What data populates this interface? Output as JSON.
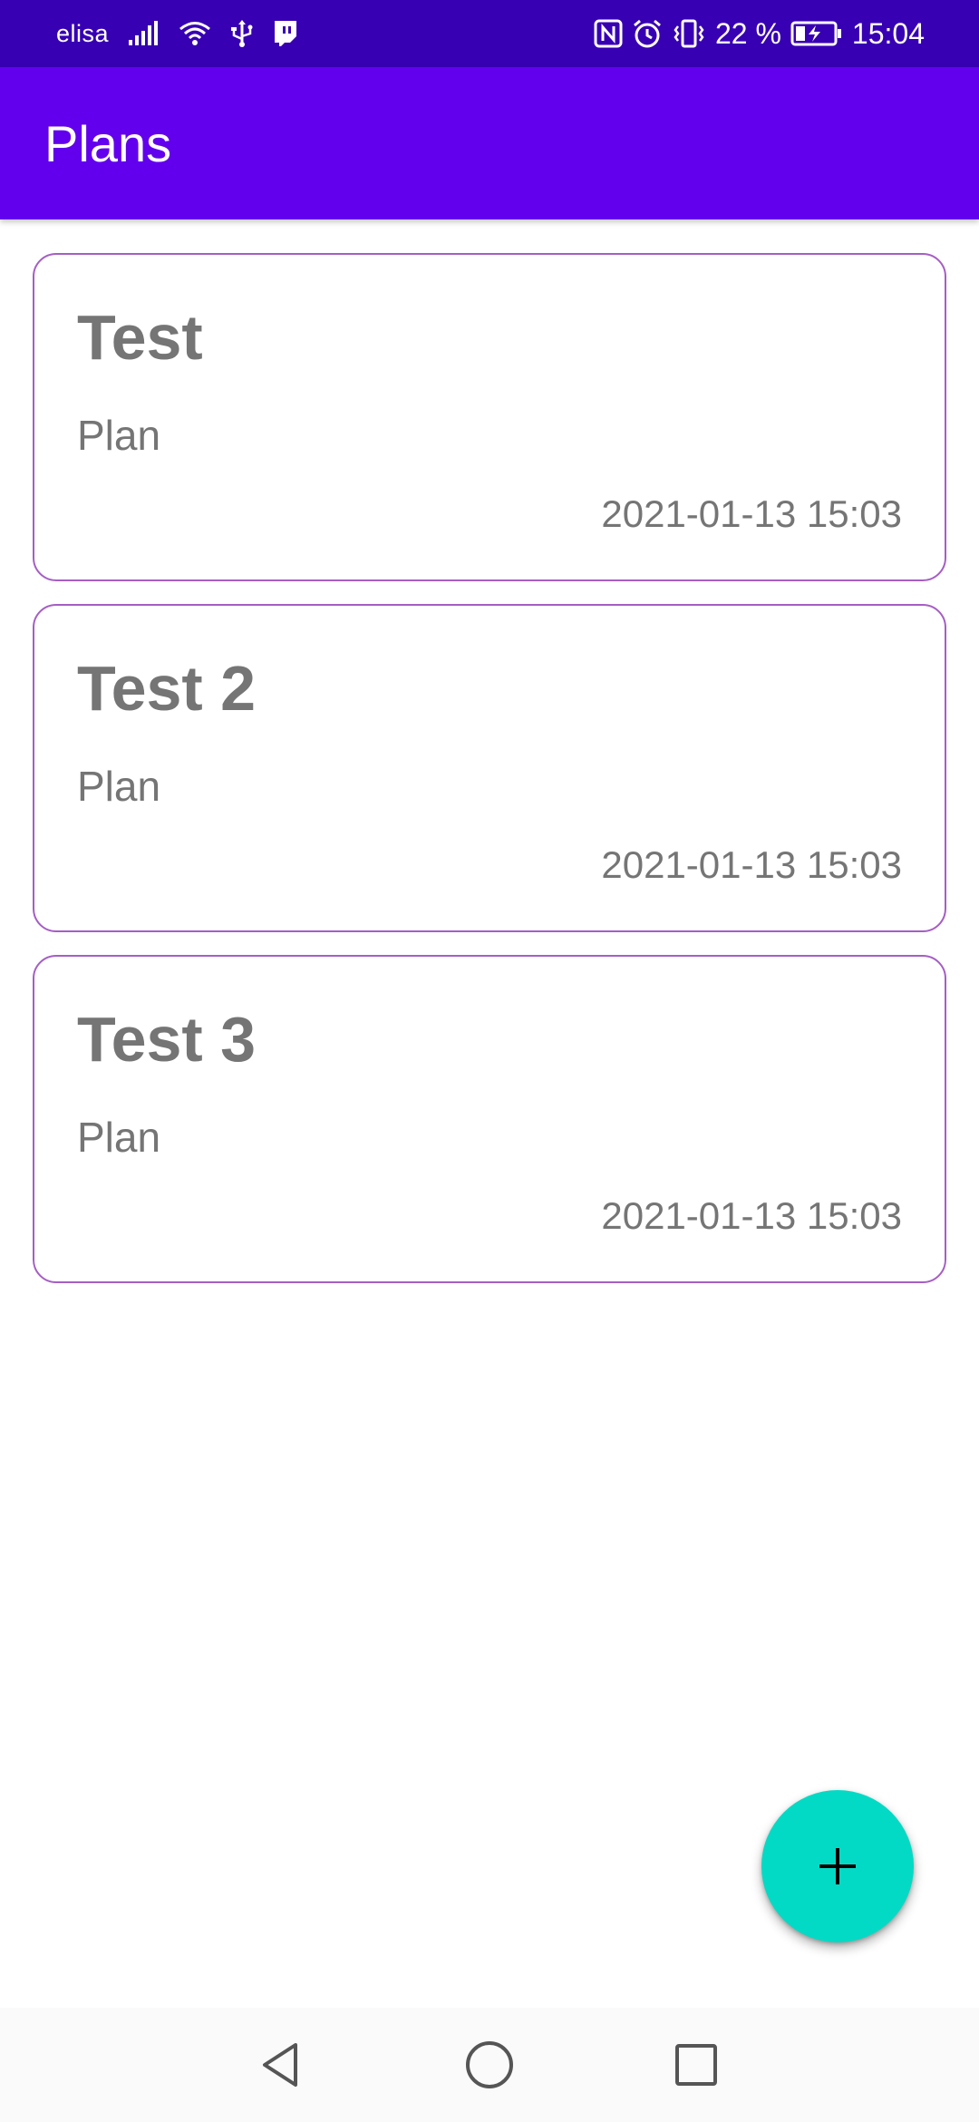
{
  "status_bar": {
    "carrier": "elisa",
    "battery_percent": "22 %",
    "time": "15:04",
    "icons": [
      "signal-icon",
      "wifi-icon",
      "usb-icon",
      "twitch-icon",
      "nfc-icon",
      "alarm-icon",
      "vibrate-icon",
      "battery-charging-icon"
    ]
  },
  "app_bar": {
    "title": "Plans"
  },
  "plans": [
    {
      "title": "Test",
      "subtitle": "Plan",
      "date": "2021-01-13 15:03"
    },
    {
      "title": "Test 2",
      "subtitle": "Plan",
      "date": "2021-01-13 15:03"
    },
    {
      "title": "Test 3",
      "subtitle": "Plan",
      "date": "2021-01-13 15:03"
    }
  ],
  "fab": {
    "icon": "plus-icon"
  },
  "nav_bar": {
    "icons": [
      "back-icon",
      "home-icon",
      "recents-icon"
    ]
  },
  "colors": {
    "status_bar": "#3700B3",
    "app_bar": "#6200EE",
    "card_border": "#A55EC4",
    "text_gray": "#757575",
    "fab": "#03DAC5"
  }
}
